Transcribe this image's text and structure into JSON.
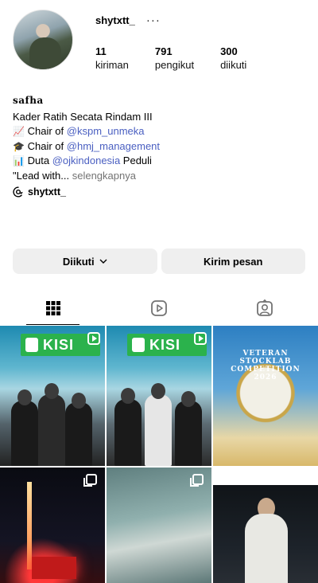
{
  "profile": {
    "username": "shytxtt_",
    "more": "···",
    "stats": [
      {
        "num": "11",
        "label": "kiriman"
      },
      {
        "num": "791",
        "label": "pengikut"
      },
      {
        "num": "300",
        "label": "diikuti"
      }
    ]
  },
  "bio": {
    "display_name": "safha",
    "line1": "Kader Ratih Secata Rindam III",
    "line2_prefix": "Chair of ",
    "line2_mention": "@kspm_unmeka",
    "line3_prefix": "Chair of ",
    "line3_mention": "@hmj_management",
    "line4_prefix": "Duta ",
    "line4_mention": "@ojkindonesia",
    "line4_suffix": " Peduli",
    "line5_text": "\"Lead with...",
    "line5_more": " selengkapnya",
    "threads_handle": "shytxtt_"
  },
  "buttons": {
    "following": "Diikuti",
    "message": "Kirim pesan"
  },
  "posts": {
    "tile1_banner": "KISI",
    "tile2_banner": "KISI",
    "tile3_title": "VETERAN STOCKLAB COMPETITION 2026"
  }
}
